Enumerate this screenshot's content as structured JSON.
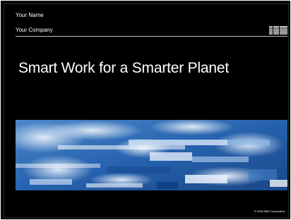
{
  "slide": {
    "presenter_name": "Your Name",
    "company": "Your Company",
    "brand": "IBM",
    "title": "Smart Work for a Smarter Planet",
    "copyright": "© 2008 IBM Corporation"
  },
  "colors": {
    "background": "#000000",
    "text": "#ffffff",
    "rule": "#bfbfbf",
    "earth_blue": "#1e5fb0"
  },
  "icons": {
    "logo": "ibm-striped-logo",
    "banner": "earth-from-space-mosaic"
  }
}
